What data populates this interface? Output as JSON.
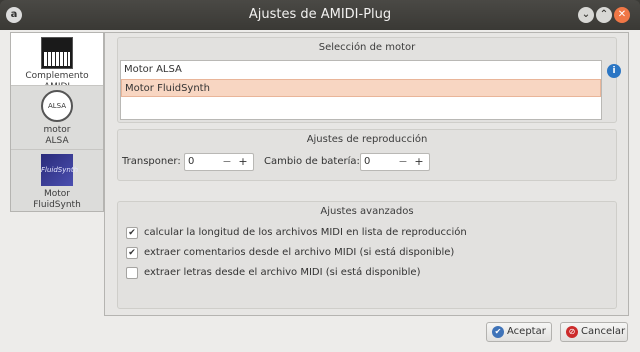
{
  "window": {
    "title": "Ajustes de AMIDI-Plug",
    "app_icon": "a"
  },
  "sidebar": {
    "items": [
      {
        "label": "Complemento AMIDI",
        "icon": "keyboard-icon"
      },
      {
        "label_line1": "motor",
        "label_line2": "ALSA",
        "icon": "alsa-icon",
        "pic_text": "ALSA"
      },
      {
        "label_line1": "Motor",
        "label_line2": "FluidSynth",
        "icon": "fluidsynth-icon",
        "pic_text": "FluidSynth"
      }
    ]
  },
  "motor": {
    "title": "Selección de motor",
    "items": [
      "Motor ALSA",
      "Motor FluidSynth"
    ],
    "selected_index": 1
  },
  "reproduccion": {
    "title": "Ajustes de reproducción",
    "transponer_label": "Transponer:",
    "transponer_value": "0",
    "bateria_label": "Cambio de batería:",
    "bateria_value": "0"
  },
  "avanzados": {
    "title": "Ajustes avanzados",
    "options": [
      {
        "label": "calcular la longitud de los archivos MIDI en lista de reproducción",
        "checked": true
      },
      {
        "label": "extraer comentarios desde el archivo MIDI (si está disponible)",
        "checked": true
      },
      {
        "label": "extraer letras desde el archivo MIDI (si está disponible)",
        "checked": false
      }
    ]
  },
  "buttons": {
    "accept": "Aceptar",
    "cancel": "Cancelar"
  },
  "colors": {
    "selection": "#f8d6c2",
    "close": "#f07746",
    "titlebar": "#3c3b37"
  }
}
